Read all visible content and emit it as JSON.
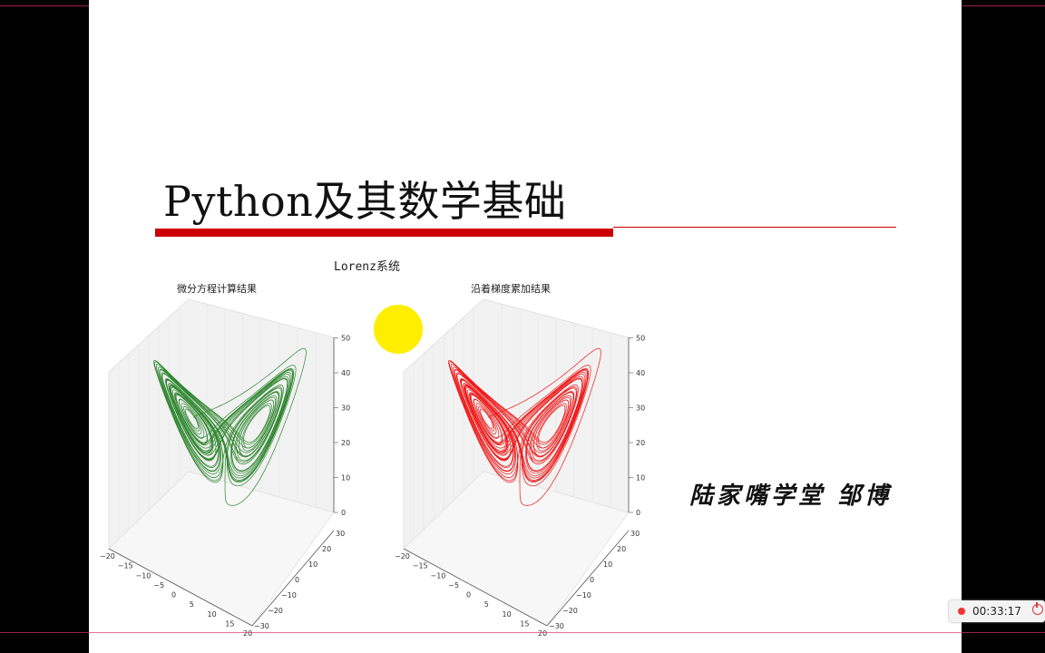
{
  "slide": {
    "title": "Python及其数学基础",
    "figure_title": "Lorenz系统",
    "left_subtitle": "微分方程计算结果",
    "right_subtitle": "沿着梯度累加结果",
    "author": "陆家嘴学堂 邹博"
  },
  "colors": {
    "accent_red": "#cc0000",
    "left_curve": "#1a7a1a",
    "right_curve": "#ee0000",
    "highlight": "#ffee00"
  },
  "axes": {
    "z_ticks": [
      "0",
      "10",
      "20",
      "30",
      "40",
      "50"
    ],
    "y_ticks": [
      "−30",
      "−20",
      "−10",
      "0",
      "10",
      "20",
      "30"
    ],
    "x_ticks": [
      "−20",
      "−15",
      "−10",
      "−5",
      "0",
      "5",
      "10",
      "15",
      "20"
    ]
  },
  "recorder": {
    "time": "00:33:17",
    "icons": [
      "record-dot-icon",
      "power-icon"
    ]
  },
  "chart_data": [
    {
      "type": "line",
      "title": "微分方程计算结果",
      "series_color": "#1a7a1a",
      "xlim": [
        -20,
        20
      ],
      "ylim": [
        -30,
        30
      ],
      "zlim": [
        0,
        50
      ]
    },
    {
      "type": "line",
      "title": "沿着梯度累加结果",
      "series_color": "#ee0000",
      "xlim": [
        -20,
        20
      ],
      "ylim": [
        -30,
        30
      ],
      "zlim": [
        0,
        50
      ]
    }
  ]
}
